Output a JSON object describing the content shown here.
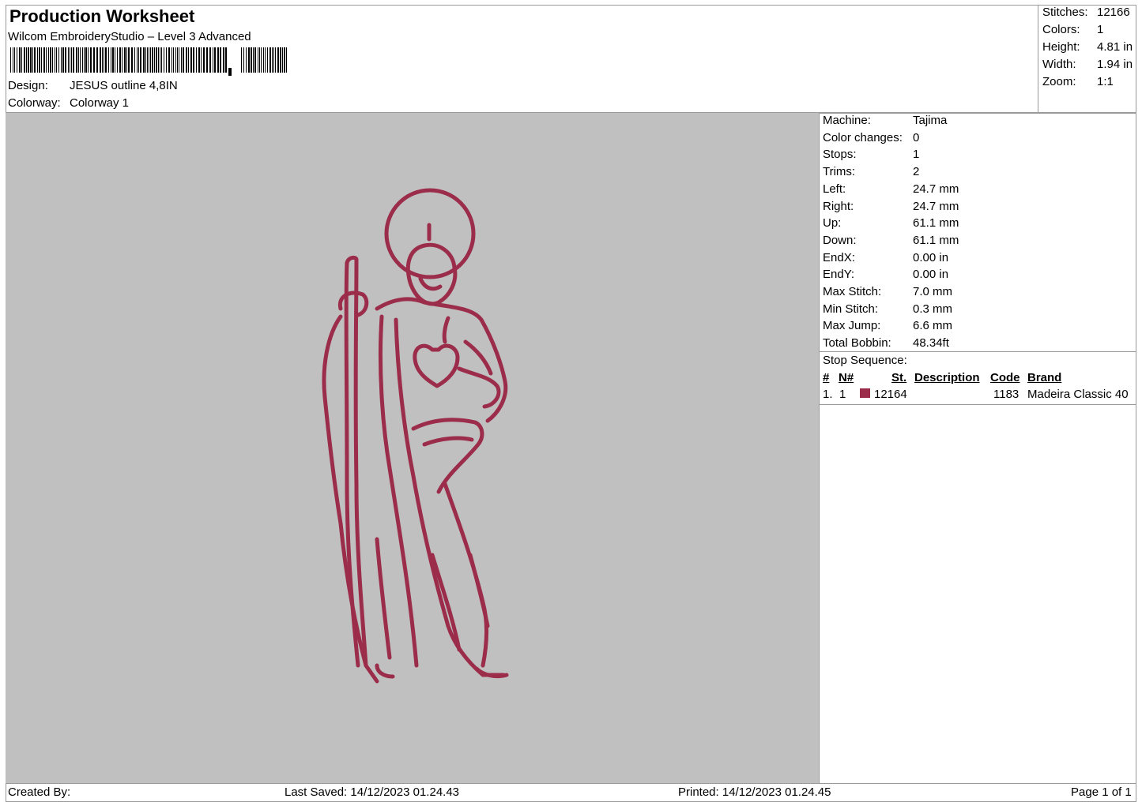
{
  "header": {
    "title": "Production Worksheet",
    "software": "Wilcom EmbroideryStudio – Level 3 Advanced",
    "design_label": "Design:",
    "design_value": "JESUS outline 4,8IN",
    "colorway_label": "Colorway:",
    "colorway_value": "Colorway 1"
  },
  "summary": [
    {
      "label": "Stitches:",
      "value": "12166"
    },
    {
      "label": "Colors:",
      "value": "1"
    },
    {
      "label": "Height:",
      "value": "4.81 in"
    },
    {
      "label": "Width:",
      "value": "1.94 in"
    },
    {
      "label": "Zoom:",
      "value": "1:1"
    }
  ],
  "details": [
    {
      "label": "Machine:",
      "value": "Tajima"
    },
    {
      "label": "Color changes:",
      "value": "0"
    },
    {
      "label": "Stops:",
      "value": "1"
    },
    {
      "label": "Trims:",
      "value": "2"
    },
    {
      "label": "Left:",
      "value": "24.7 mm"
    },
    {
      "label": "Right:",
      "value": "24.7 mm"
    },
    {
      "label": "Up:",
      "value": "61.1 mm"
    },
    {
      "label": "Down:",
      "value": "61.1 mm"
    },
    {
      "label": "EndX:",
      "value": "0.00 in"
    },
    {
      "label": "EndY:",
      "value": "0.00 in"
    },
    {
      "label": "Max Stitch:",
      "value": "7.0 mm"
    },
    {
      "label": "Min Stitch:",
      "value": "0.3 mm"
    },
    {
      "label": "Max Jump:",
      "value": "6.6 mm"
    },
    {
      "label": "Total Bobbin:",
      "value": "48.34ft"
    }
  ],
  "stop_sequence": {
    "title": "Stop Sequence:",
    "headers": {
      "num": "#",
      "n": "N#",
      "st": "St.",
      "description": "Description",
      "code": "Code",
      "brand": "Brand"
    },
    "rows": [
      {
        "num": "1.",
        "n": "1",
        "st": "12164",
        "description": "",
        "code": "1183",
        "brand": "Madeira Classic 40",
        "color": "#9b2d4b"
      }
    ]
  },
  "footer": {
    "created_by": "Created By:",
    "last_saved": "Last Saved: 14/12/2023 01.24.43",
    "printed": "Printed: 14/12/2023 01.24.45",
    "page": "Page 1 of 1"
  },
  "colors": {
    "thread": "#9b2d4b",
    "stitch_stroke": "#8a3f55",
    "canvas": "#c0c0c0"
  }
}
